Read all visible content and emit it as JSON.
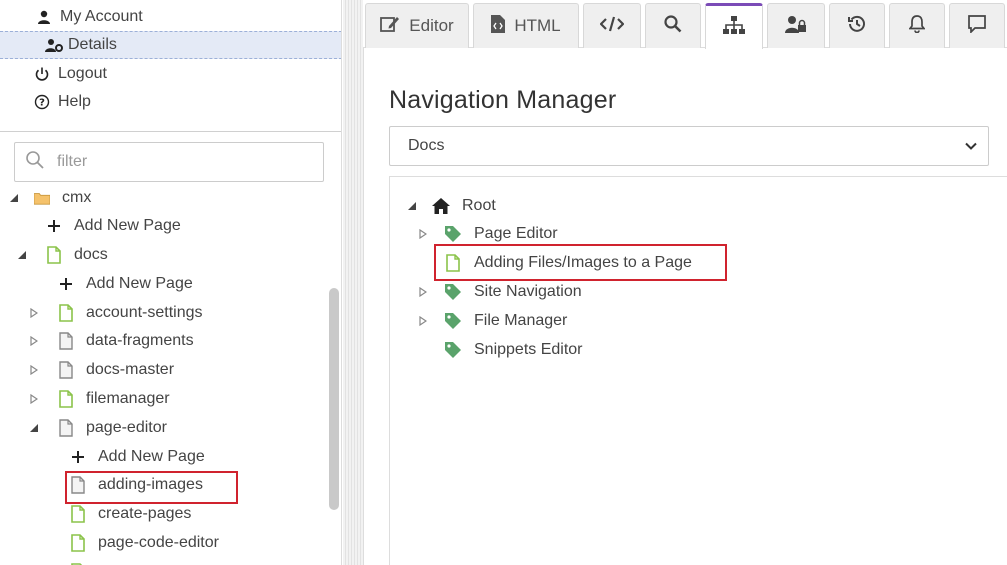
{
  "account_menu": {
    "my_account": "My Account",
    "details": "Details",
    "logout": "Logout",
    "help": "Help"
  },
  "filter": {
    "placeholder": "filter"
  },
  "page_tree": {
    "cmx_label": "cmx",
    "cmx_add": "Add New Page",
    "docs_label": "docs",
    "docs_add": "Add New Page",
    "account_settings": "account-settings",
    "data_fragments": "data-fragments",
    "docs_master": "docs-master",
    "filemanager": "filemanager",
    "page_editor": "page-editor",
    "page_editor_add": "Add New Page",
    "adding_images": "adding-images",
    "create_pages": "create-pages",
    "page_code_editor": "page-code-editor"
  },
  "tabs": {
    "editor": "Editor",
    "html": "HTML"
  },
  "navigation_manager": {
    "title": "Navigation Manager",
    "selected_site": "Docs",
    "root": "Root",
    "items": {
      "page_editor": "Page Editor",
      "adding_files": "Adding Files/Images to a Page",
      "site_navigation": "Site Navigation",
      "file_manager": "File Manager",
      "snippets_editor": "Snippets Editor"
    }
  },
  "colors": {
    "accent": "#7b4bb7",
    "highlight": "#d0232e",
    "page_green": "#8bc34a",
    "tag_green": "#5aa36b",
    "selection": "#e4eaf6"
  }
}
